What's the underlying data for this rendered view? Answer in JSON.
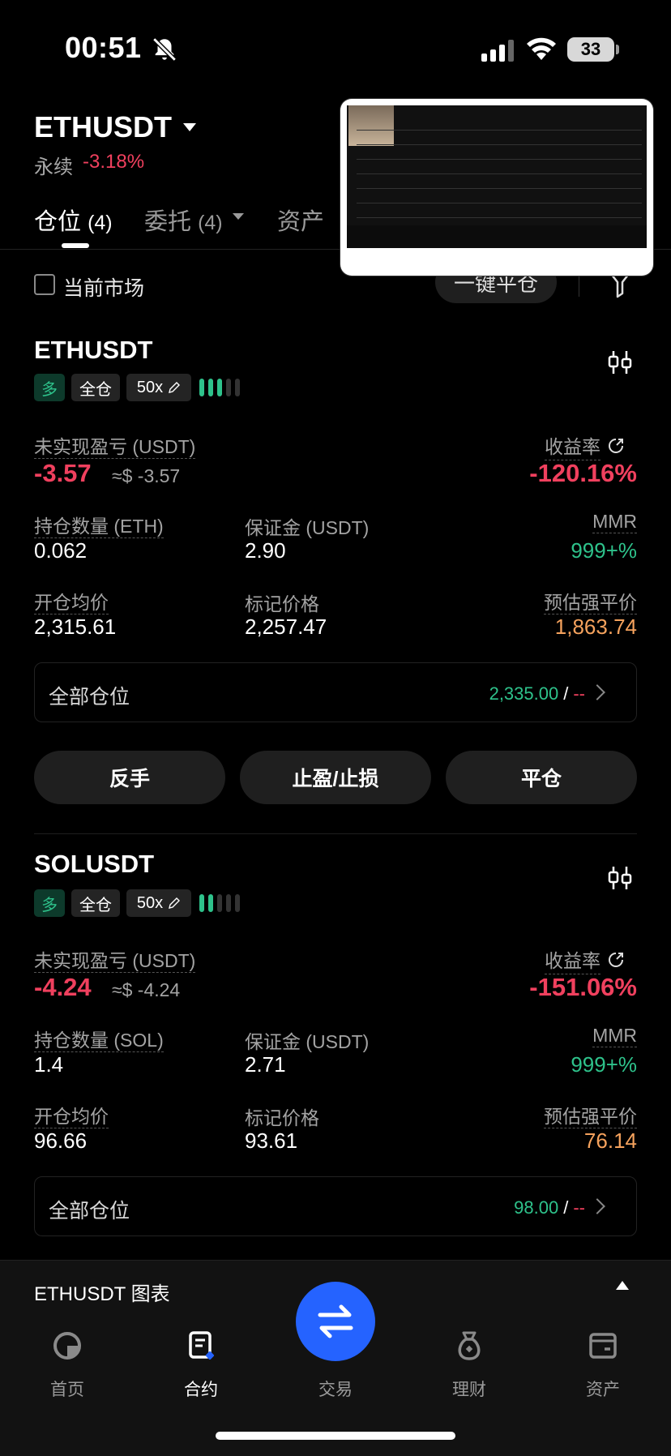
{
  "status_bar": {
    "time": "00:51",
    "battery": "33"
  },
  "header": {
    "pair": "ETHUSDT",
    "contract_type": "永续",
    "change": "-3.18%"
  },
  "tabs": [
    {
      "label": "仓位",
      "count": "(4)"
    },
    {
      "label": "委托",
      "count": "(4)"
    },
    {
      "label": "资产"
    }
  ],
  "filter": {
    "checkbox_label": "当前市场",
    "close_all_label": "一键平仓"
  },
  "positions": [
    {
      "symbol": "ETHUSDT",
      "side": "多",
      "margin_mode": "全仓",
      "leverage": "50x",
      "adl_level": 3,
      "pnl_label": "未实现盈亏 (USDT)",
      "pnl": "-3.57",
      "pnl_approx": "≈$ -3.57",
      "roe_label": "收益率",
      "roe": "-120.16%",
      "size_label": "持仓数量 (ETH)",
      "size": "0.062",
      "margin_label": "保证金 (USDT)",
      "margin": "2.90",
      "mmr_label": "MMR",
      "mmr": "999+%",
      "entry_label": "开仓均价",
      "entry": "2,315.61",
      "mark_label": "标记价格",
      "mark": "2,257.47",
      "liq_label": "预估强平价",
      "liq": "1,863.74",
      "all_label": "全部仓位",
      "all_value": "2,335.00",
      "all_sep": "/",
      "all_dash": "--"
    },
    {
      "symbol": "SOLUSDT",
      "side": "多",
      "margin_mode": "全仓",
      "leverage": "50x",
      "adl_level": 2,
      "pnl_label": "未实现盈亏 (USDT)",
      "pnl": "-4.24",
      "pnl_approx": "≈$ -4.24",
      "roe_label": "收益率",
      "roe": "-151.06%",
      "size_label": "持仓数量 (SOL)",
      "size": "1.4",
      "margin_label": "保证金 (USDT)",
      "margin": "2.71",
      "mmr_label": "MMR",
      "mmr": "999+%",
      "entry_label": "开仓均价",
      "entry": "96.66",
      "mark_label": "标记价格",
      "mark": "93.61",
      "liq_label": "预估强平价",
      "liq": "76.14",
      "all_label": "全部仓位",
      "all_value": "98.00",
      "all_sep": "/",
      "all_dash": "--"
    }
  ],
  "actions": {
    "reverse": "反手",
    "tpsl": "止盈/止损",
    "close": "平仓"
  },
  "chart_bar": {
    "label": "ETHUSDT 图表"
  },
  "nav": [
    {
      "label": "首页",
      "icon": "home-icon"
    },
    {
      "label": "合约",
      "icon": "contract-icon"
    },
    {
      "label": "交易",
      "icon": "swap-icon"
    },
    {
      "label": "理财",
      "icon": "earn-icon"
    },
    {
      "label": "资产",
      "icon": "wallet-icon"
    }
  ],
  "colors": {
    "red": "#f0405e",
    "green": "#2ec28b",
    "orange": "#f5a25d",
    "accent": "#2563ff"
  }
}
